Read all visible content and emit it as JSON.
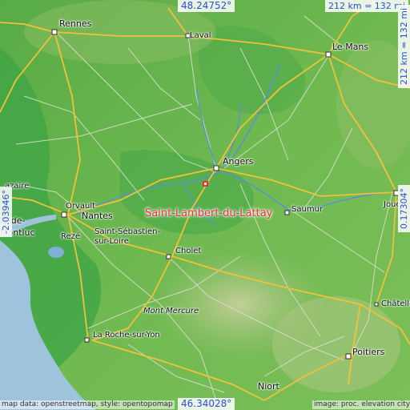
{
  "map": {
    "place": "Saint-Lambert-du-Lattay",
    "coords": {
      "north": "48.24752°",
      "south": "46.34028°",
      "west": "-2.03946°",
      "east": "0.17304°",
      "scale_h": "212 km = 132 mi",
      "scale_v": "212 km = 132 mi"
    },
    "cities": [
      "Rennes",
      "Laval",
      "Le Mans",
      "Angers",
      "Saumur",
      "Joué-lès",
      "Orvault",
      "Nantes",
      "Rezé",
      "Saint-Sébastien-",
      "sur-Loire",
      "Cholet",
      "Mont Mercure",
      "La Roche-sur-Yon",
      "Niort",
      "Châtelle",
      "Poitiers",
      "azaire",
      "le-de-",
      "Montluc"
    ],
    "attribution_left": "map data: openstreetmap, style: opentopomap",
    "attribution_right": "image: proc. elevation city"
  },
  "colors": {
    "sea": "#9ec3dc",
    "lowland": "#37a143",
    "plain": "#6cb64f",
    "hills": "#b8c58d",
    "road_major": "#f2c13a",
    "road_minor": "#d9d9c8",
    "river": "#5a8fd6",
    "marker": "#e8303a"
  }
}
